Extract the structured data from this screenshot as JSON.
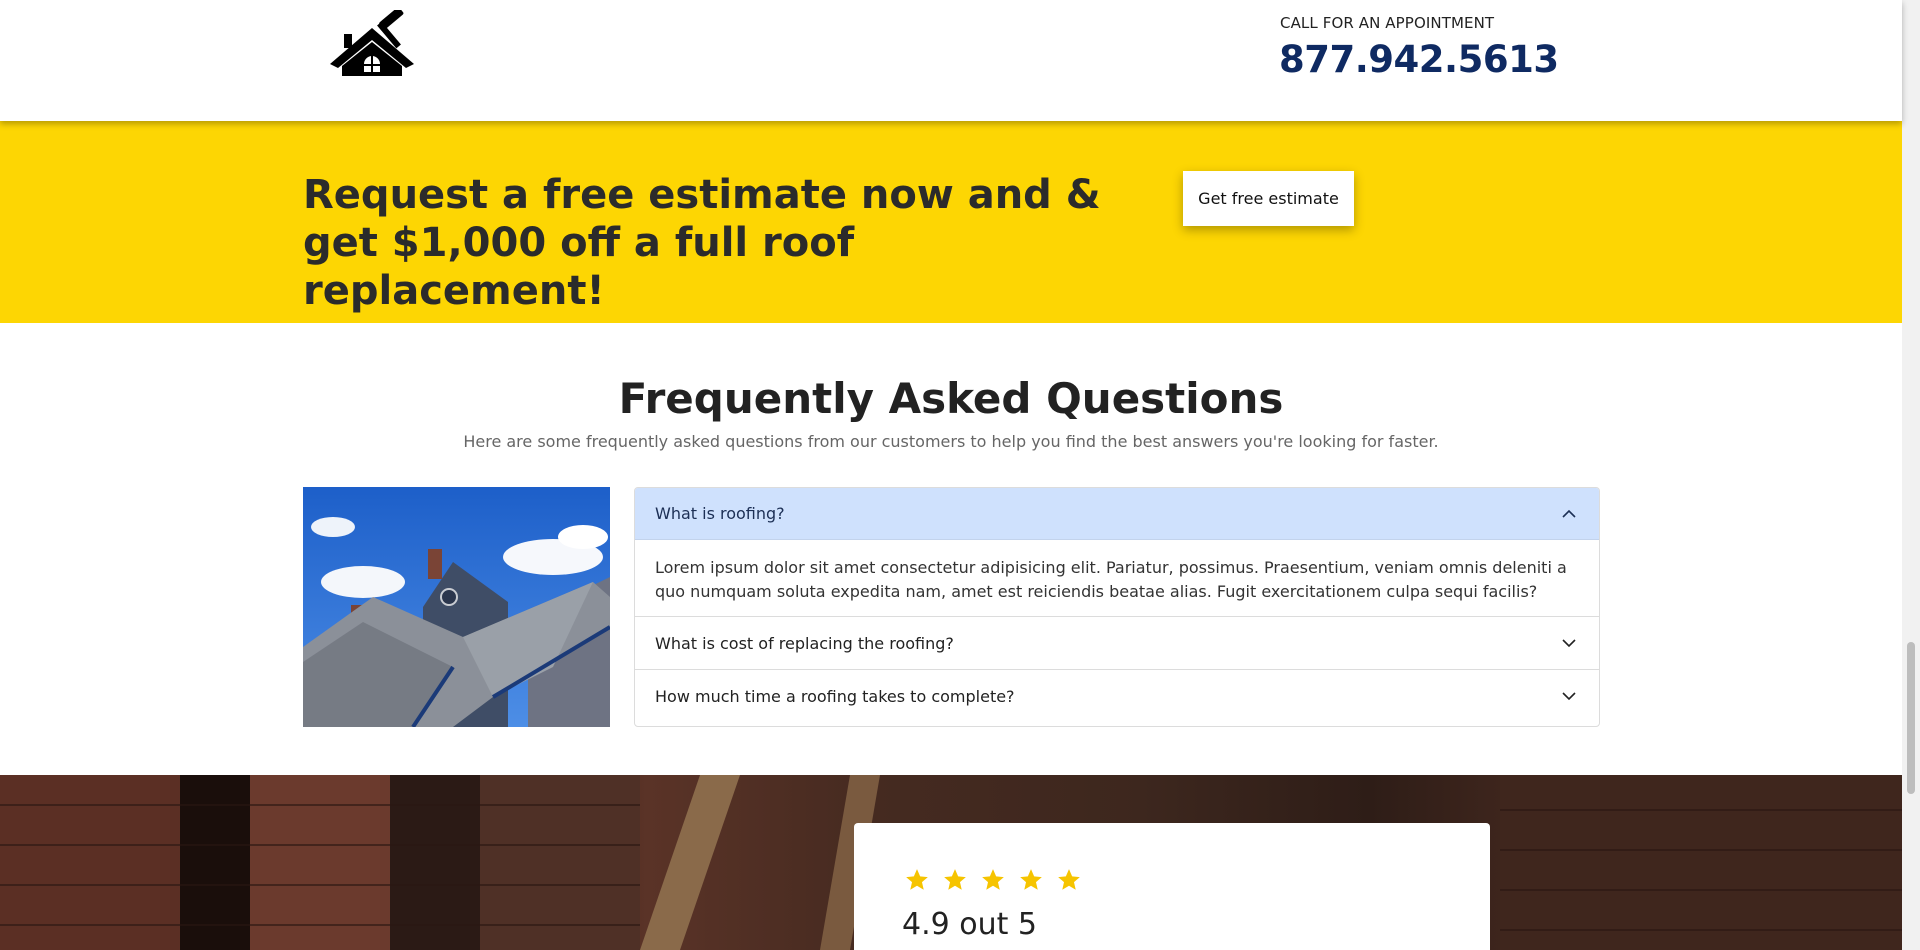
{
  "header": {
    "logo_icon": "house-hammer-icon",
    "call_label": "CALL FOR AN APPOINTMENT",
    "phone": "877.942.5613"
  },
  "promo": {
    "title": "Request a free estimate now and & get $1,000 off a full roof replacement!",
    "button_label": "Get free estimate",
    "background_color": "#fdd603"
  },
  "faq": {
    "title": "Frequently Asked Questions",
    "subtitle": "Here are some frequently asked questions from our customers to help you find the best answers you're looking for faster.",
    "items": [
      {
        "question": "What is roofing?",
        "answer": "Lorem ipsum dolor sit amet consectetur adipisicing elit. Pariatur, possimus. Praesentium, veniam omnis deleniti a quo numquam soluta expedita nam, amet est reiciendis beatae alias. Fugit exercitationem culpa sequi facilis?",
        "expanded": true
      },
      {
        "question": "What is cost of replacing the roofing?",
        "expanded": false
      },
      {
        "question": "How much time a roofing takes to complete?",
        "expanded": false
      }
    ],
    "active_color": "#cfe1fd"
  },
  "reviews": {
    "stars": 5,
    "rating_text": "4.9 out 5",
    "star_color": "#f6c400"
  }
}
